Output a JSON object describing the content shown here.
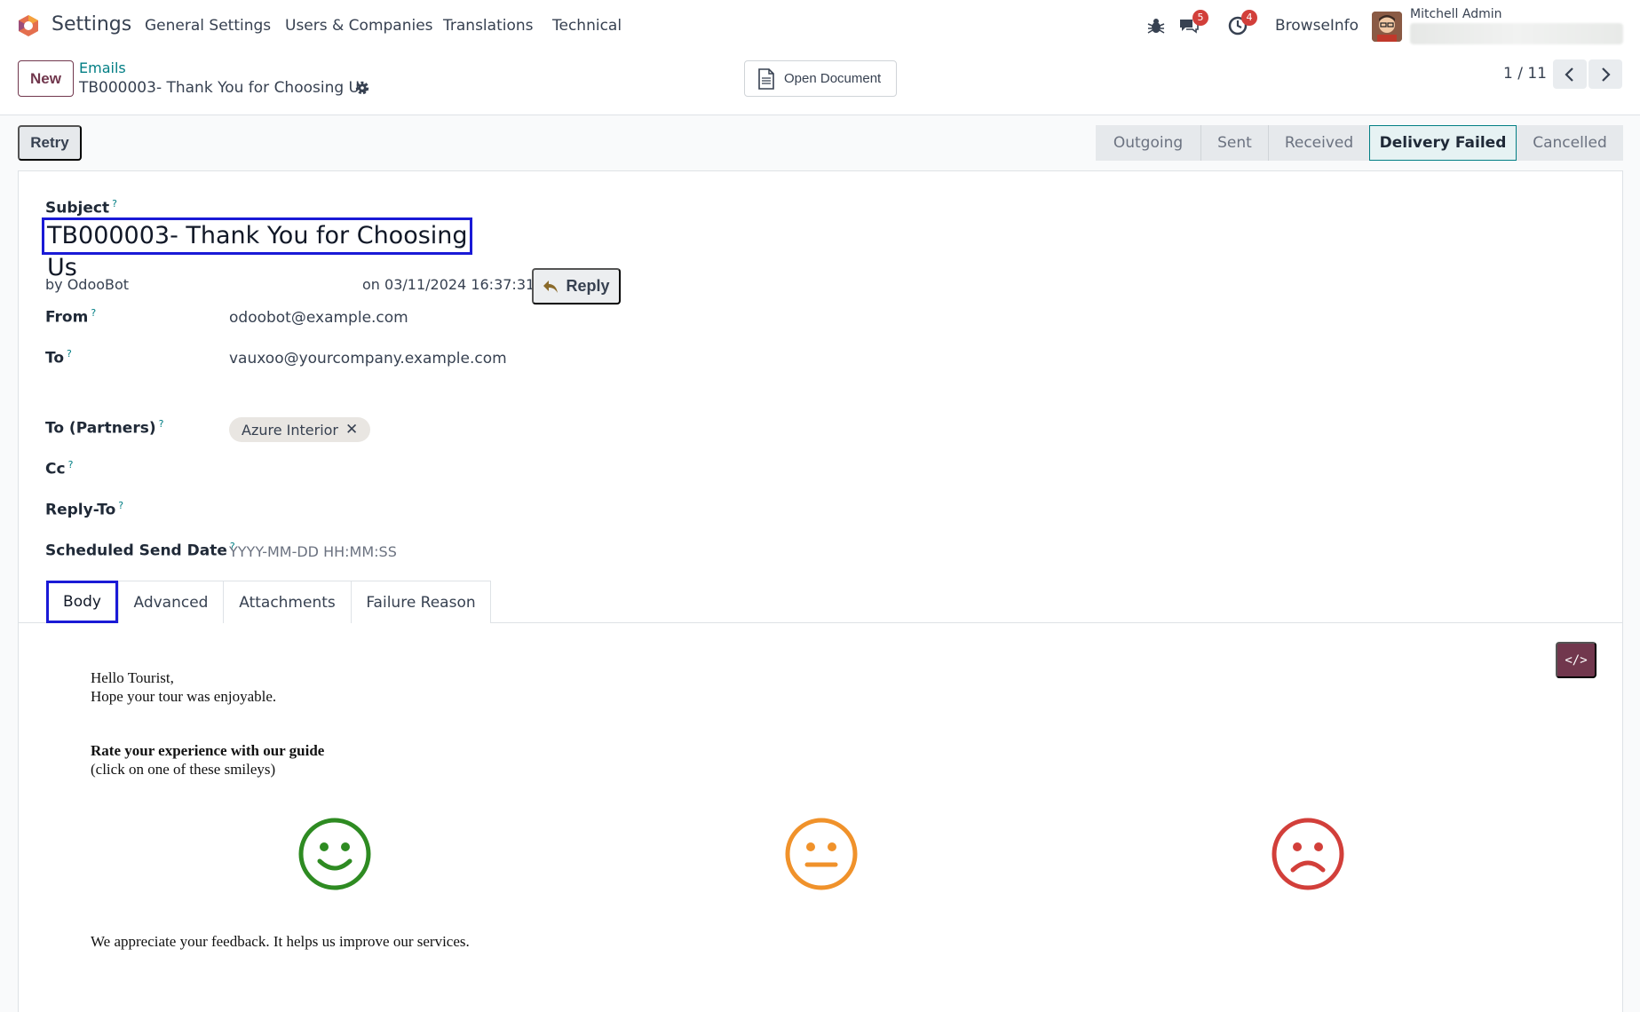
{
  "navbar": {
    "app_name": "Settings",
    "menu": [
      "General Settings",
      "Users & Companies",
      "Translations",
      "Technical"
    ],
    "messages_badge": "5",
    "activities_badge": "4",
    "company": "BrowseInfo",
    "user": "Mitchell Admin"
  },
  "control": {
    "new_label": "New",
    "breadcrumb_parent": "Emails",
    "breadcrumb_current": "TB000003- Thank You for Choosing Us",
    "open_document": "Open Document",
    "pager": "1 / 11"
  },
  "statusbar": {
    "retry_label": "Retry",
    "stages": [
      "Outgoing",
      "Sent",
      "Received",
      "Delivery Failed",
      "Cancelled"
    ],
    "active_stage": "Delivery Failed"
  },
  "form": {
    "subject_label": "Subject",
    "subject": "TB000003- Thank You for Choosing Us",
    "author": "by OdooBot",
    "date": "on 03/11/2024 16:37:31",
    "reply_label": "Reply",
    "from_label": "From",
    "from": "odoobot@example.com",
    "to_label": "To",
    "to": "vauxoo@yourcompany.example.com",
    "to_partners_label": "To (Partners)",
    "partner_tag": "Azure Interior",
    "cc_label": "Cc",
    "reply_to_label": "Reply-To",
    "scheduled_label": "Scheduled Send Date",
    "scheduled_placeholder": "YYYY-MM-DD HH:MM:SS",
    "help_mark": "?"
  },
  "tabs": [
    "Body",
    "Advanced",
    "Attachments",
    "Failure Reason"
  ],
  "body": {
    "greeting": "Hello Tourist,",
    "line2": "Hope your tour was enjoyable.",
    "rate_title": "Rate your experience with our guide",
    "rate_hint": "(click on one of these smileys)",
    "closing": "We appreciate your feedback. It helps us improve our services.",
    "code_toggle": "</>"
  },
  "colors": {
    "brand": "#71374d",
    "link": "#017e84",
    "highlight": "#1a1ad6",
    "happy": "#2e8b22",
    "neutral": "#f0922b",
    "sad": "#d23f3a"
  },
  "icons": [
    "bug-icon",
    "chat-icon",
    "clock-icon",
    "gear-icon",
    "document-icon",
    "chevron-left-icon",
    "chevron-right-icon",
    "reply-arrow-icon",
    "close-icon",
    "code-icon",
    "happy-smiley-icon",
    "neutral-smiley-icon",
    "sad-smiley-icon"
  ]
}
